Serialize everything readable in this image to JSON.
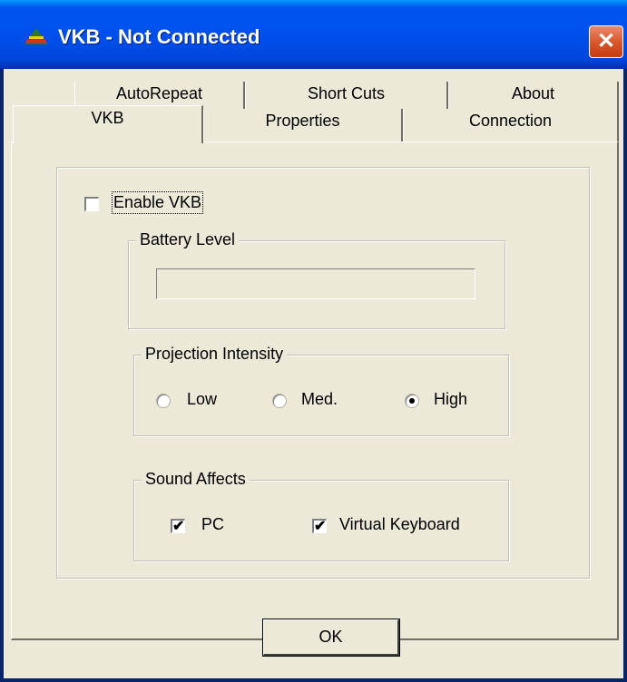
{
  "window": {
    "title": "VKB - Not Connected",
    "close_glyph": "✕"
  },
  "tabs": {
    "back_row": [
      {
        "label": "AutoRepeat"
      },
      {
        "label": "Short Cuts"
      },
      {
        "label": "About"
      }
    ],
    "front_row": [
      {
        "label": "VKB",
        "selected": true
      },
      {
        "label": "Properties"
      },
      {
        "label": "Connection"
      }
    ]
  },
  "vkb_panel": {
    "enable_label": "Enable VKB",
    "enable_checked": false,
    "battery": {
      "title": "Battery Level",
      "level": 0
    },
    "projection": {
      "title": "Projection Intensity",
      "options": [
        {
          "label": "Low",
          "selected": false
        },
        {
          "label": "Med.",
          "selected": false
        },
        {
          "label": "High",
          "selected": true
        }
      ]
    },
    "sound": {
      "title": "Sound Affects",
      "options": [
        {
          "label": "PC",
          "checked": true
        },
        {
          "label": "Virtual Keyboard",
          "checked": true
        }
      ]
    }
  },
  "buttons": {
    "ok_label": "OK"
  },
  "icons": {
    "title_icon": "vkb-triangle-icon",
    "close_icon": "close-icon"
  },
  "colors": {
    "title_bar": "#0053ee",
    "close_button": "#d9582f",
    "dialog_bg": "#ece9d8"
  }
}
